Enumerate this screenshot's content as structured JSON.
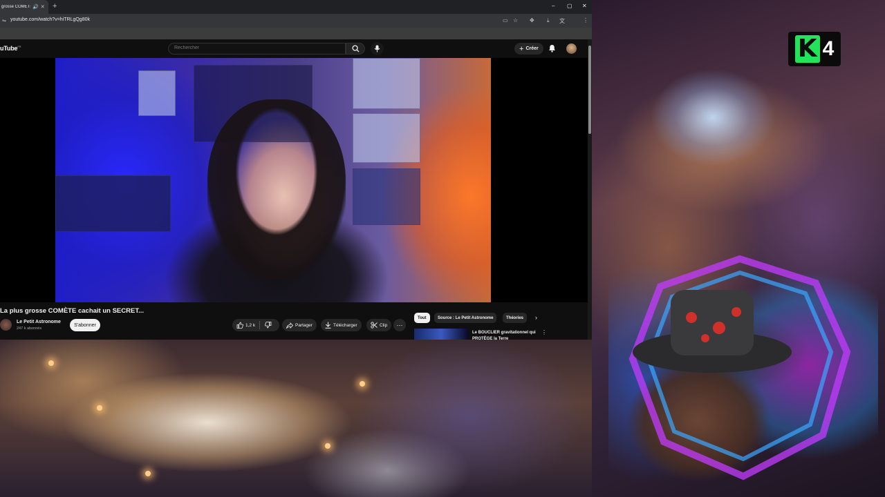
{
  "browser": {
    "tab_title": "grosse COMÈTE ca",
    "new_tab_symbol": "+",
    "window_controls": {
      "minimize": "–",
      "maximize": "▢",
      "close": "✕"
    },
    "url": "youtube.com/watch?v=hiTRLgQg80k"
  },
  "youtube": {
    "logo_text": "uTube",
    "logo_region": "FR",
    "search_placeholder": "Rechercher",
    "create_label": "Créer",
    "create_symbol": "+"
  },
  "video": {
    "title": "La plus grosse COMÈTE cachait un SECRET...",
    "channel_name": "Le Petit Astronome",
    "subscribers": "247 k abonnés",
    "subscribe_label": "S'abonner",
    "like_count": "1,2 k",
    "share_label": "Partager",
    "download_label": "Télécharger",
    "clip_label": "Clip",
    "more_symbol": "⋯"
  },
  "recommendations": {
    "chips": [
      "Tout",
      "Source : Le Petit Astronome",
      "Théories"
    ],
    "next_symbol": "›",
    "items": [
      {
        "title": "Le BOUCLIER gravitationnel qui PROTÈGE la Terre"
      }
    ],
    "more_symbol": "⋮"
  },
  "overlay": {
    "logo_letter": "K",
    "logo_number": "4"
  },
  "colors": {
    "youtube_bg": "#0f0f0f",
    "chip_active_bg": "#f1f1f1",
    "logo_green": "#22e35a"
  }
}
